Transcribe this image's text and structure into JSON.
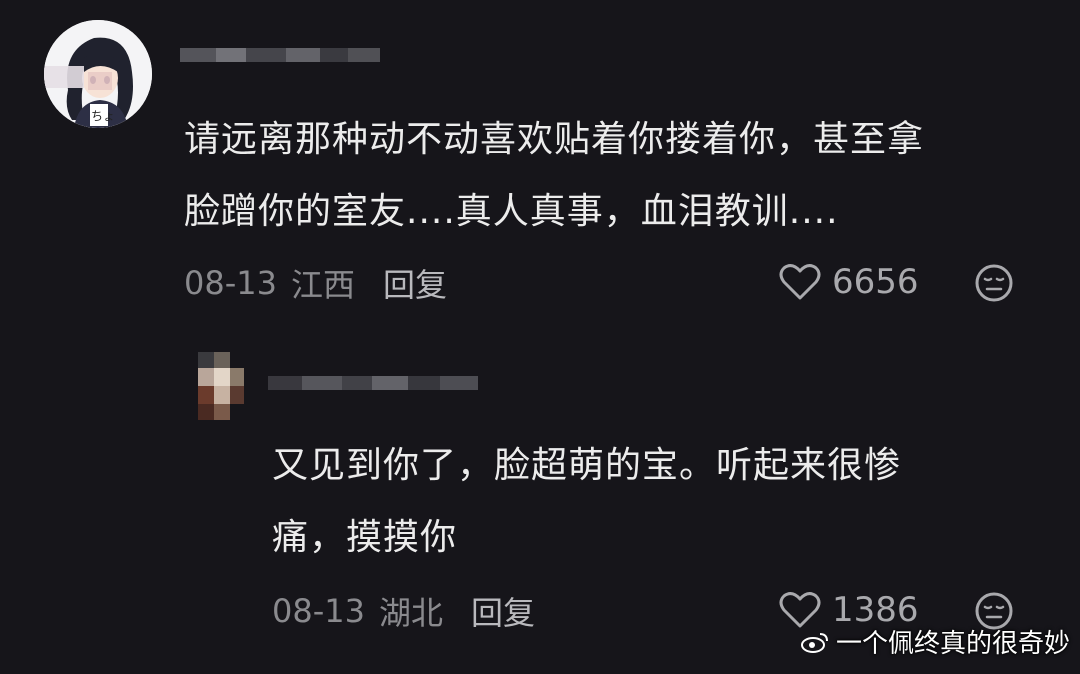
{
  "colors": {
    "background": "#16151a",
    "text_primary": "#ececec",
    "text_secondary": "#8a8a8e",
    "reply_label": "#b9b9bd",
    "icon": "#a9a9ad"
  },
  "comments": [
    {
      "avatar": "anime-girl-avatar",
      "username_blurred": true,
      "text_lines": [
        "请远离那种动不动喜欢贴着你搂着你，甚至拿",
        "脸蹭你的室友....真人真事，血泪教训...."
      ],
      "date": "08-13",
      "location": "江西",
      "reply_label": "回复",
      "likes": "6656",
      "like_icon": "heart-outline-icon",
      "dislike_icon": "meh-face-icon"
    },
    {
      "avatar": "blurred-avatar",
      "username_blurred": true,
      "text_lines": [
        "又见到你了，脸超萌的宝。听起来很惨",
        "痛，摸摸你"
      ],
      "date": "08-13",
      "location": "湖北",
      "reply_label": "回复",
      "likes": "1386",
      "like_icon": "heart-outline-icon",
      "dislike_icon": "meh-face-icon"
    }
  ],
  "watermark": {
    "text": "一个佩终真的很奇妙",
    "icon": "weibo-logo-icon"
  }
}
